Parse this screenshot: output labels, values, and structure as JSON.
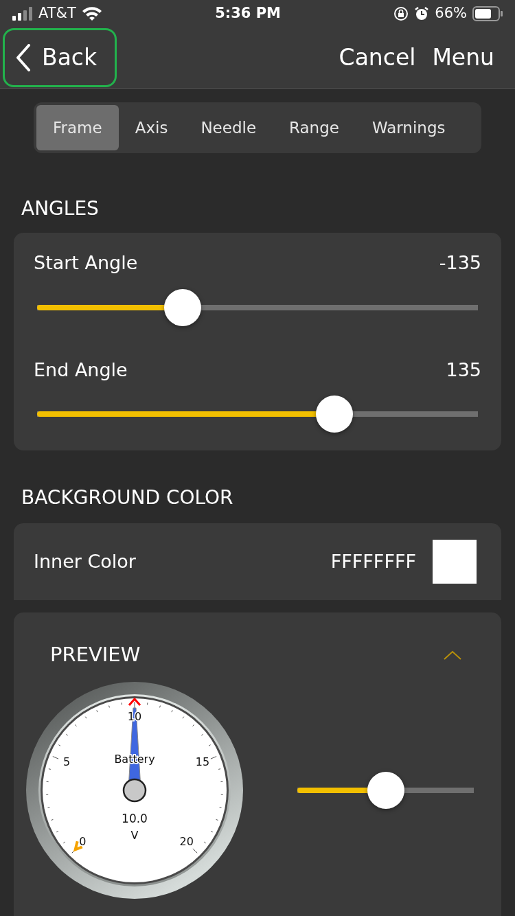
{
  "status_bar": {
    "carrier": "AT&T",
    "time": "5:36 PM",
    "battery_text": "66%"
  },
  "nav": {
    "back": "Back",
    "cancel": "Cancel",
    "menu": "Menu"
  },
  "tabs": [
    {
      "label": "Frame",
      "selected": true
    },
    {
      "label": "Axis",
      "selected": false
    },
    {
      "label": "Needle",
      "selected": false
    },
    {
      "label": "Range",
      "selected": false
    },
    {
      "label": "Warnings",
      "selected": false
    }
  ],
  "angles": {
    "title": "ANGLES",
    "sliders": [
      {
        "label": "Start Angle",
        "reading": "-135",
        "level": 0.33
      },
      {
        "label": "End Angle",
        "reading": "135",
        "level": 0.675
      }
    ]
  },
  "background_color": {
    "title": "BACKGROUND COLOR",
    "label": "Inner Color",
    "value": "FFFFFFFF",
    "color": "#ffffff"
  },
  "preview": {
    "title": "PREVIEW",
    "expanded": true,
    "gauge": {
      "ticks": [
        {
          "label": "0"
        },
        {
          "label": "5"
        },
        {
          "label": "10"
        },
        {
          "label": "15"
        },
        {
          "label": "20"
        }
      ],
      "name": "Battery",
      "reading": "10.0",
      "unit": "V"
    },
    "level": 0.5
  }
}
